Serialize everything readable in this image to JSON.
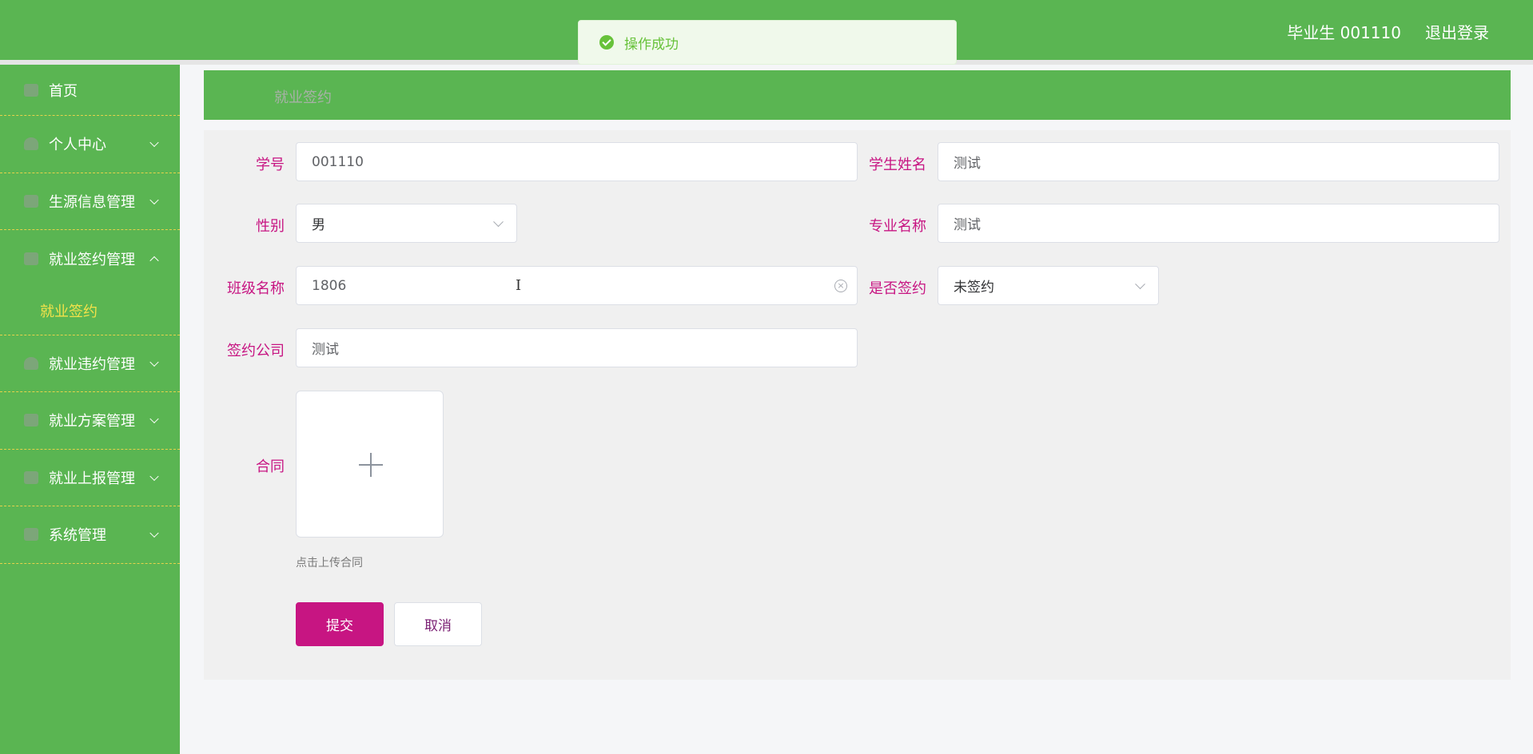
{
  "header": {
    "user_label": "毕业生 001110",
    "logout_label": "退出登录"
  },
  "toast": {
    "message": "操作成功"
  },
  "sidebar": {
    "items": [
      {
        "label": "首页"
      },
      {
        "label": "个人中心"
      },
      {
        "label": "生源信息管理"
      },
      {
        "label": "就业签约管理"
      },
      {
        "label": "就业违约管理"
      },
      {
        "label": "就业方案管理"
      },
      {
        "label": "就业上报管理"
      },
      {
        "label": "系统管理"
      }
    ],
    "active_sub": "就业签约"
  },
  "breadcrumb": "就业签约",
  "form": {
    "student_no_label": "学号",
    "student_no": "001110",
    "student_name_label": "学生姓名",
    "student_name": "测试",
    "gender_label": "性别",
    "gender": "男",
    "major_label": "专业名称",
    "major": "测试",
    "class_label": "班级名称",
    "class_name": "1806",
    "signed_label": "是否签约",
    "signed": "未签约",
    "company_label": "签约公司",
    "company": "测试",
    "contract_label": "合同",
    "upload_tip": "点击上传合同",
    "submit_label": "提交",
    "cancel_label": "取消"
  },
  "colors": {
    "theme_green": "#5ab552",
    "accent_magenta": "#c71582",
    "active_sub_yellow": "#f3e24a",
    "success": "#67c23a"
  }
}
